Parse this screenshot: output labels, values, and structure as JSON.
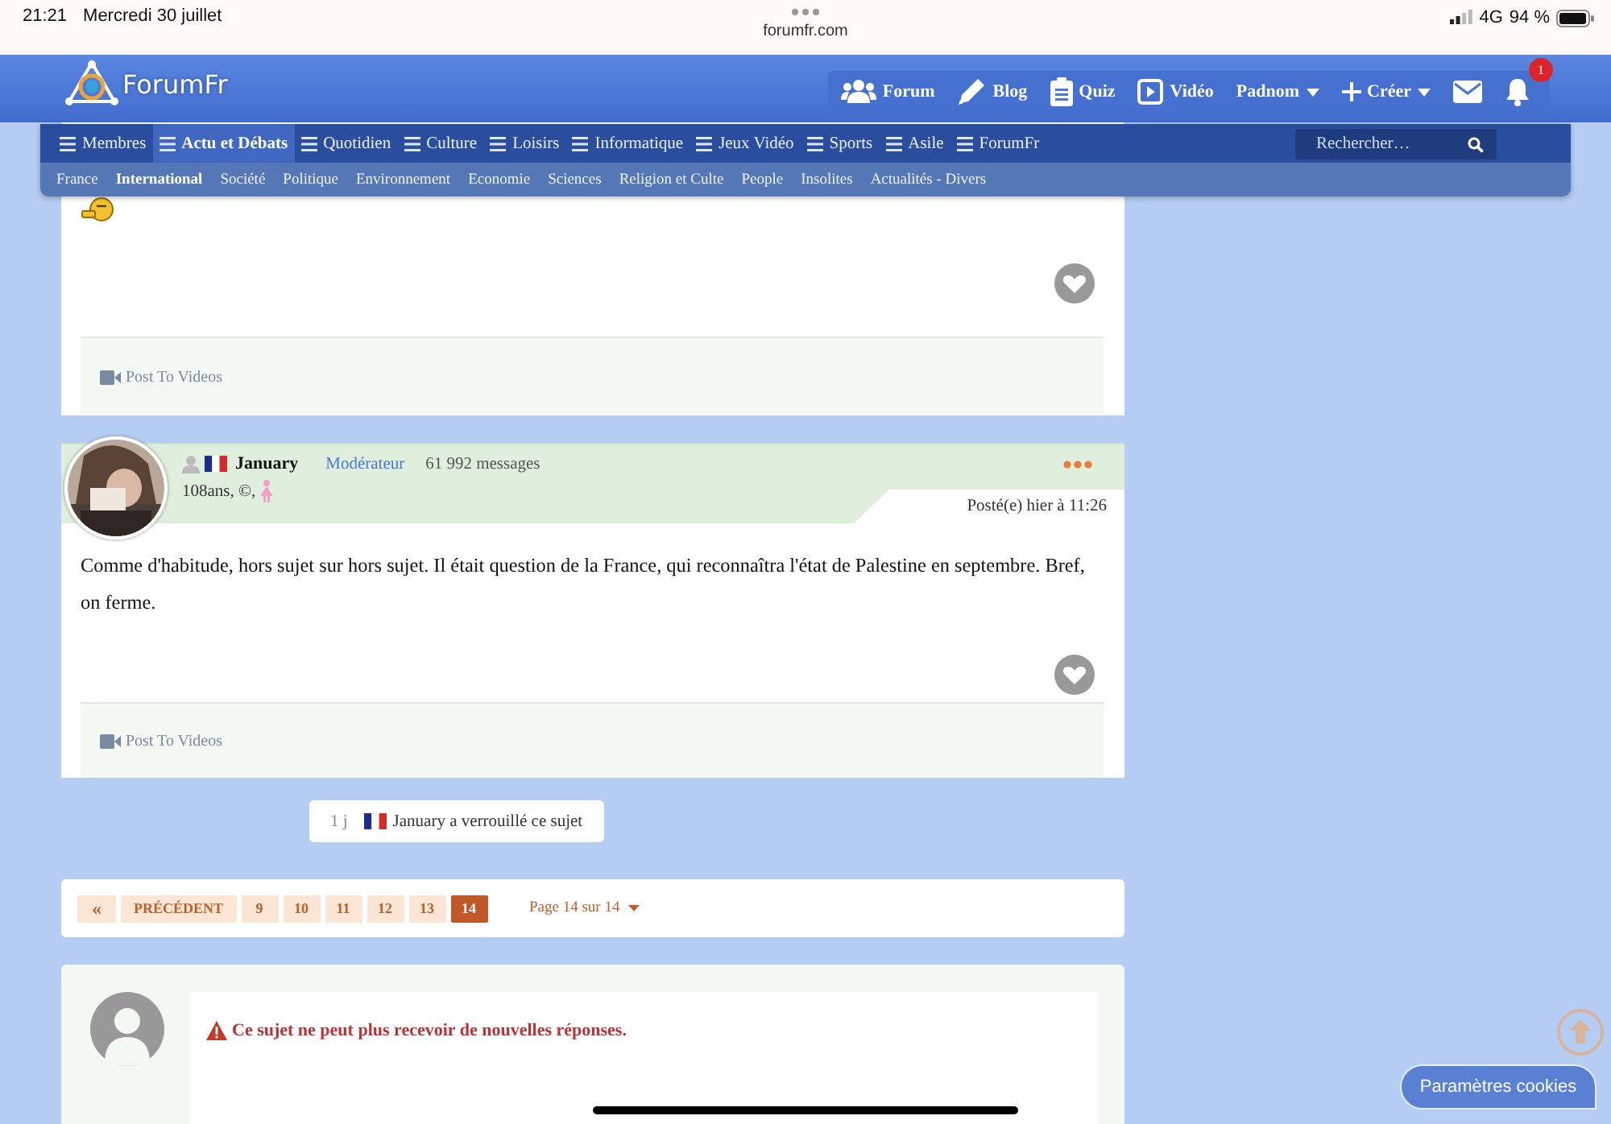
{
  "status_bar": {
    "time": "21:21",
    "date": "Mercredi 30 juillet",
    "url": "forumfr.com",
    "network": "4G",
    "battery": "94 %"
  },
  "header": {
    "logo": "ForumFr",
    "links": [
      {
        "kind": "forum",
        "label": "Forum"
      },
      {
        "kind": "blog",
        "label": "Blog"
      },
      {
        "kind": "quiz",
        "label": "Quiz"
      },
      {
        "kind": "video",
        "label": "Vidéo"
      },
      {
        "kind": "dropdown",
        "label": "Padnom"
      },
      {
        "kind": "create",
        "label": "Créer"
      },
      {
        "kind": "mail"
      },
      {
        "kind": "bell",
        "badge": "1"
      }
    ]
  },
  "nav": {
    "items": [
      {
        "label": "Membres",
        "selected": false
      },
      {
        "label": "Actu et Débats",
        "selected": true
      },
      {
        "label": "Quotidien",
        "selected": false
      },
      {
        "label": "Culture",
        "selected": false
      },
      {
        "label": "Loisirs",
        "selected": false
      },
      {
        "label": "Informatique",
        "selected": false
      },
      {
        "label": "Jeux Vidéo",
        "selected": false
      },
      {
        "label": "Sports",
        "selected": false
      },
      {
        "label": "Asile",
        "selected": false
      },
      {
        "label": "ForumFr",
        "selected": false
      }
    ],
    "search": {
      "placeholder": "Rechercher…"
    },
    "subitems": [
      {
        "label": "France",
        "selected": false
      },
      {
        "label": "International",
        "selected": true
      },
      {
        "label": "Société",
        "selected": false
      },
      {
        "label": "Politique",
        "selected": false
      },
      {
        "label": "Environnement",
        "selected": false
      },
      {
        "label": "Economie",
        "selected": false
      },
      {
        "label": "Sciences",
        "selected": false
      },
      {
        "label": "Religion et Culte",
        "selected": false
      },
      {
        "label": "People",
        "selected": false
      },
      {
        "label": "Insolites",
        "selected": false
      },
      {
        "label": "Actualités - Divers",
        "selected": false
      }
    ]
  },
  "posts": [
    {
      "kind": "partial",
      "footer_link": "Post To Videos"
    },
    {
      "kind": "full",
      "author": "January",
      "role": "Modérateur",
      "messages": "61 992 messages",
      "details": "108ans, ©,",
      "posted": "Posté(e) hier à 11:26",
      "body": "Comme d'habitude, hors sujet sur hors sujet. Il était question de la France, qui reconnaîtra l'état de Palestine en septembre. Bref, on ferme.",
      "footer_link": "Post To Videos"
    }
  ],
  "lock_notice": {
    "age": "1 j",
    "text": "January a verrouillé ce sujet"
  },
  "pagination": {
    "first": "«",
    "previous": "PRÉCÉDENT",
    "pages": [
      {
        "label": "9",
        "selected": false
      },
      {
        "label": "10",
        "selected": false
      },
      {
        "label": "11",
        "selected": false
      },
      {
        "label": "12",
        "selected": false
      },
      {
        "label": "13",
        "selected": false
      },
      {
        "label": "14",
        "selected": true
      }
    ],
    "summary": "Page 14 sur 14"
  },
  "reply": {
    "message": "Ce sujet ne peut plus recevoir de nouvelles réponses."
  },
  "cookies_button": "Paramètres cookies"
}
